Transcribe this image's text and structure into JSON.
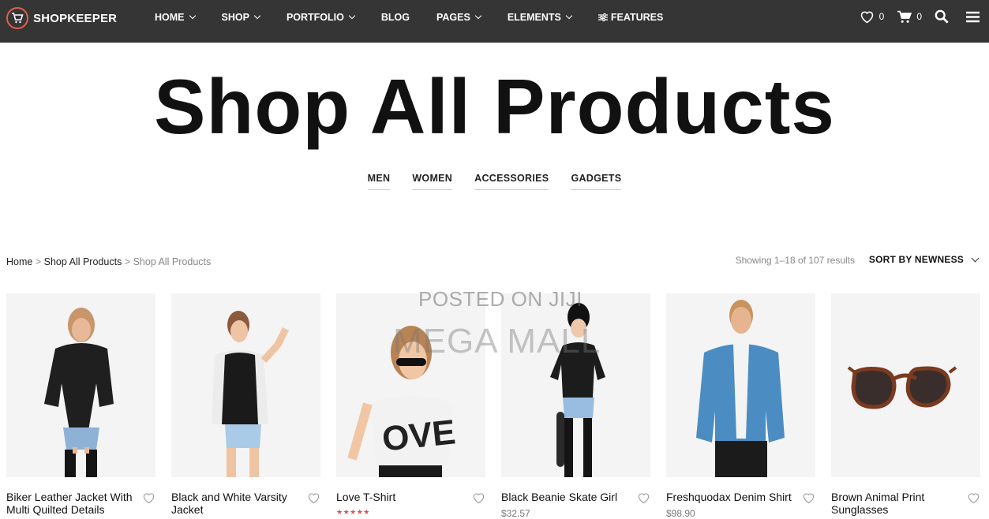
{
  "header": {
    "logo": "SHOPKEEPER",
    "nav": [
      {
        "label": "HOME",
        "dropdown": true
      },
      {
        "label": "SHOP",
        "dropdown": true
      },
      {
        "label": "PORTFOLIO",
        "dropdown": true
      },
      {
        "label": "BLOG",
        "dropdown": false
      },
      {
        "label": "PAGES",
        "dropdown": true
      },
      {
        "label": "ELEMENTS",
        "dropdown": true
      },
      {
        "label": "FEATURES",
        "dropdown": false,
        "icon": "sliders-icon"
      }
    ],
    "wishlist_count": "0",
    "cart_count": "0",
    "icons": [
      "heart-icon",
      "cart-icon",
      "search-icon",
      "menu-icon"
    ]
  },
  "page": {
    "title": "Shop All Products",
    "categories": [
      "MEN",
      "WOMEN",
      "ACCESSORIES",
      "GADGETS"
    ]
  },
  "breadcrumb": {
    "home": "Home",
    "sep1": ">",
    "section": "Shop All Products",
    "sep2": ">",
    "current": "Shop All Products"
  },
  "results": {
    "text": "Showing 1–18 of 107 results",
    "sort_label": "SORT BY NEWNESS"
  },
  "products": [
    {
      "name": "Biker Leather Jacket With Multi Quilted Details",
      "price": ""
    },
    {
      "name": "Black and White Varsity Jacket",
      "price": ""
    },
    {
      "name": "Love T-Shirt",
      "price": "",
      "rating": "★★★★★"
    },
    {
      "name": "Black Beanie Skate Girl",
      "price": "$32.57"
    },
    {
      "name": "Freshquodax Denim Shirt",
      "price": "$98.90"
    },
    {
      "name": "Brown Animal Print Sunglasses",
      "price": ""
    }
  ],
  "watermark": {
    "line1": "POSTED ON JIJI",
    "line2": "MEGA MALL"
  },
  "colors": {
    "topbar": "#353535",
    "accent": "#e0604a",
    "rating": "#d9534f"
  }
}
